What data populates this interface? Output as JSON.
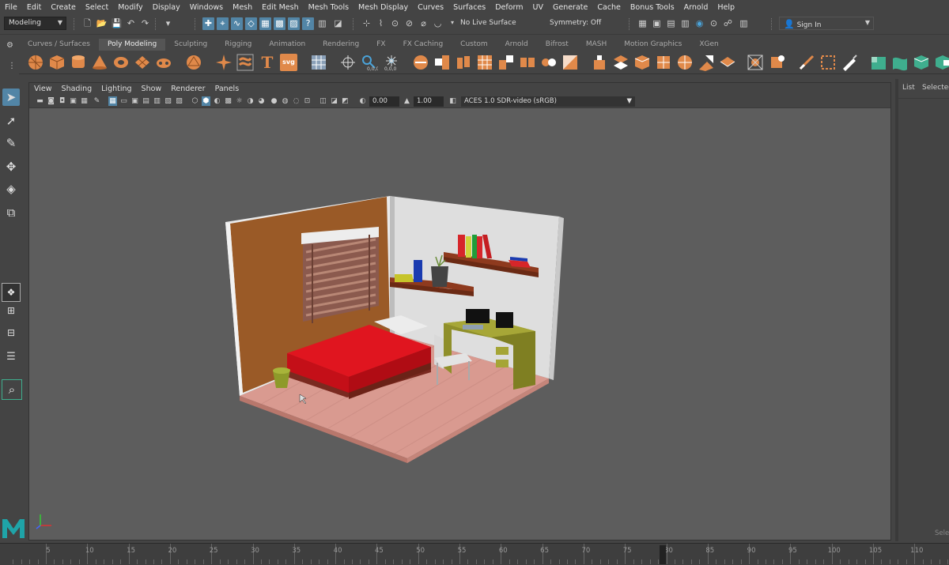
{
  "menubar": [
    "File",
    "Edit",
    "Create",
    "Select",
    "Modify",
    "Display",
    "Windows",
    "Mesh",
    "Edit Mesh",
    "Mesh Tools",
    "Mesh Display",
    "Curves",
    "Surfaces",
    "Deform",
    "UV",
    "Generate",
    "Cache",
    "Bonus Tools",
    "Arnold",
    "Help"
  ],
  "status": {
    "mode": "Modeling",
    "live_surface": "No Live Surface",
    "symmetry": "Symmetry: Off",
    "signin": "Sign In"
  },
  "shelf_tabs": [
    "Curves / Surfaces",
    "Poly Modeling",
    "Sculpting",
    "Rigging",
    "Animation",
    "Rendering",
    "FX",
    "FX Caching",
    "Custom",
    "Arnold",
    "Bifrost",
    "MASH",
    "Motion Graphics",
    "XGen"
  ],
  "shelf_active": "Poly Modeling",
  "panel_menu": [
    "View",
    "Shading",
    "Lighting",
    "Show",
    "Renderer",
    "Panels"
  ],
  "panel_toolbar": {
    "exposure": "0.00",
    "gamma": "1.00",
    "color_space": "ACES 1.0 SDR-video (sRGB)"
  },
  "right_panel": {
    "list": "List",
    "selected": "Selected",
    "bottom": "Sele"
  },
  "timeline": {
    "ticks": [
      "5",
      "10",
      "15",
      "20",
      "25",
      "30",
      "35",
      "40",
      "45",
      "50",
      "55",
      "60",
      "65",
      "70",
      "75",
      "80",
      "85",
      "90",
      "95",
      "100",
      "105",
      "110"
    ]
  },
  "colors": {
    "accent": "#5285a6",
    "shelf_orange": "#e0894a",
    "shelf_green": "#3fae8e",
    "viewport": "#5d5d5d"
  }
}
